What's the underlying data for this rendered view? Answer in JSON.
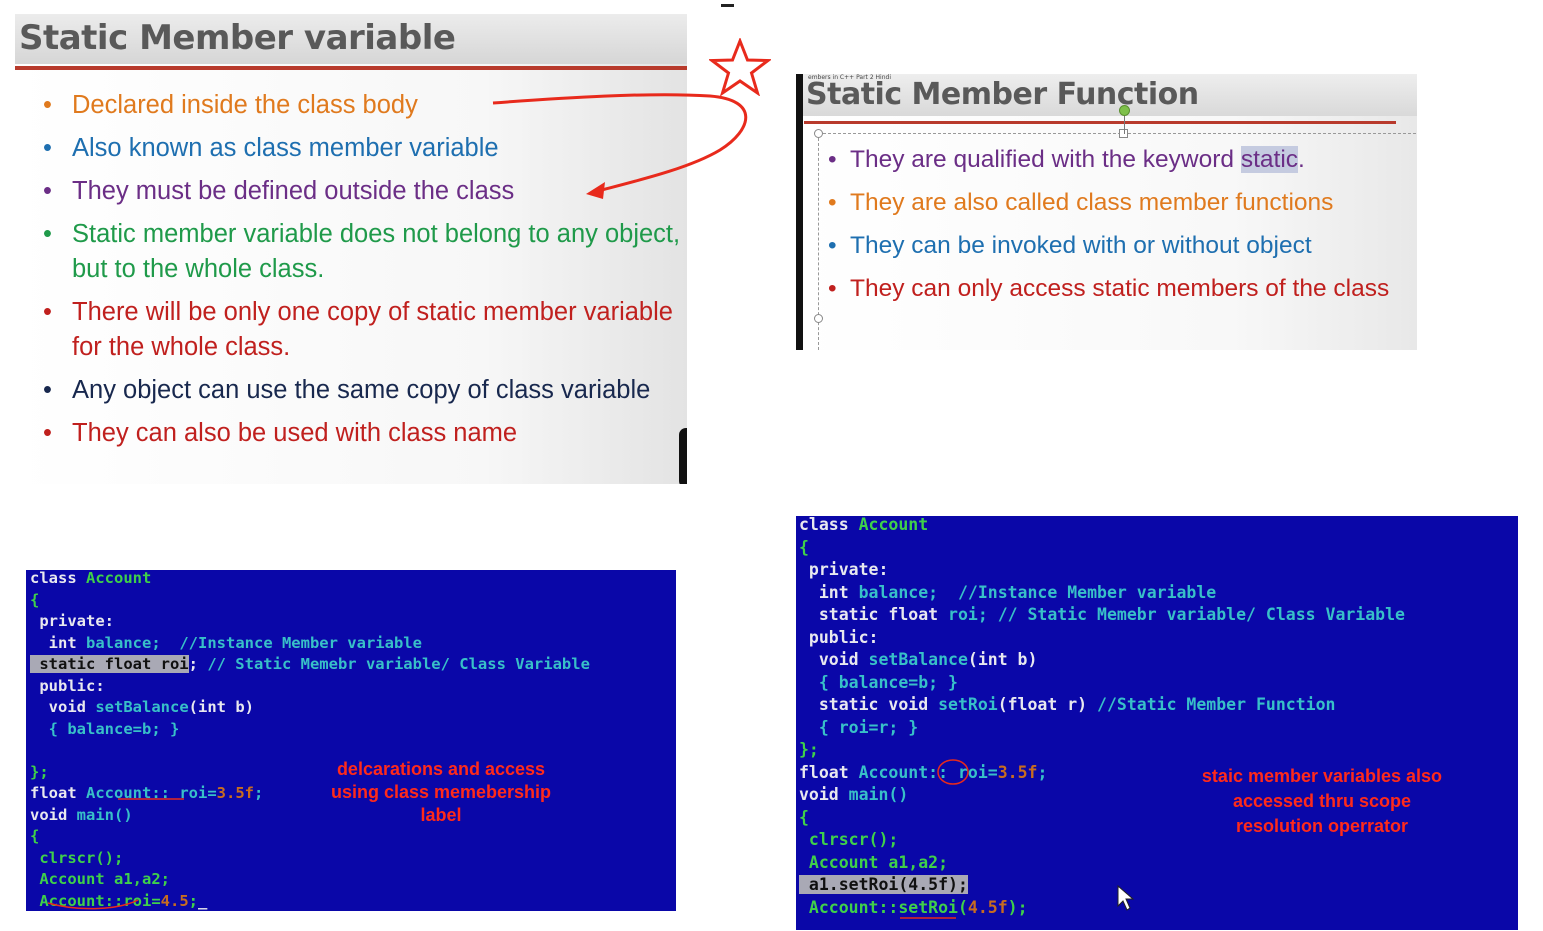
{
  "panel_variable": {
    "title": "Static Member variable",
    "bullets": [
      {
        "text": "Declared inside the class body",
        "color": "#e07a1e"
      },
      {
        "text": "Also known as class member variable",
        "color": "#1e6fb0"
      },
      {
        "text": "They must be defined outside the class",
        "color": "#6b2e86"
      },
      {
        "text": "Static member variable does not belong to any object, but to the whole class.",
        "color": "#1f9a4a"
      },
      {
        "text": "There will be only one copy of static member variable for the whole class.",
        "color": "#c0201e"
      },
      {
        "text": "Any object can use the same copy of class variable",
        "color": "#18284e"
      },
      {
        "text": "They can also be used with class name",
        "color": "#c0201e"
      }
    ],
    "bullet_symbol": "•"
  },
  "panel_function": {
    "tiny_caption": "embers in C++ Part 2 Hindi",
    "title": "Static Member Function",
    "bullets": [
      {
        "pre": "They are qualified with the keyword ",
        "hl": "static",
        "post": ".",
        "color": "#6b2e86"
      },
      {
        "pre": "They are also called class member functions",
        "hl": "",
        "post": "",
        "color": "#e07a1e"
      },
      {
        "pre": "They can be invoked with or without object",
        "hl": "",
        "post": "",
        "color": "#1e6fb0"
      },
      {
        "pre": "They can only access static members of the class",
        "hl": "",
        "post": "",
        "color": "#c0201e"
      }
    ],
    "bullet_symbol": "•"
  },
  "code_left": {
    "lines": [
      [
        {
          "t": "class ",
          "c": "c-white"
        },
        {
          "t": "Account",
          "c": "c-green"
        }
      ],
      [
        {
          "t": "{",
          "c": "c-green"
        }
      ],
      [
        {
          "t": " private:",
          "c": "c-white"
        }
      ],
      [
        {
          "t": "  int ",
          "c": "c-white"
        },
        {
          "t": "balance;  ",
          "c": "c-cyan"
        },
        {
          "t": "//Instance Member variable",
          "c": "c-cyan"
        }
      ],
      [
        {
          "t": " static float roi",
          "c": "hl"
        },
        {
          "t": "; ",
          "c": "c-white"
        },
        {
          "t": "// Static Memebr variable/ Class Variable",
          "c": "c-cyan"
        }
      ],
      [
        {
          "t": " public:",
          "c": "c-white"
        }
      ],
      [
        {
          "t": "  void ",
          "c": "c-white"
        },
        {
          "t": "setBalance",
          "c": "c-cyan"
        },
        {
          "t": "(int b)",
          "c": "c-white"
        }
      ],
      [
        {
          "t": "  { balance=b; }",
          "c": "c-cyan"
        }
      ],
      [
        {
          "t": "",
          "c": "c-white"
        }
      ],
      [
        {
          "t": "};",
          "c": "c-green"
        }
      ],
      [
        {
          "t": "float ",
          "c": "c-white"
        },
        {
          "t": "Account",
          "c": "c-cyan"
        },
        {
          "t": ":: roi=",
          "c": "c-cyan"
        },
        {
          "t": "3.5f",
          "c": "c-orange"
        },
        {
          "t": ";",
          "c": "c-cyan"
        }
      ],
      [
        {
          "t": "void ",
          "c": "c-white"
        },
        {
          "t": "main()",
          "c": "c-cyan"
        }
      ],
      [
        {
          "t": "{",
          "c": "c-green"
        }
      ],
      [
        {
          "t": " clrscr();",
          "c": "c-green"
        }
      ],
      [
        {
          "t": " Account a1,a2;",
          "c": "c-green"
        }
      ],
      [
        {
          "t": " Account::roi=",
          "c": "c-green"
        },
        {
          "t": "4.5",
          "c": "c-orange"
        },
        {
          "t": ";",
          "c": "c-green"
        },
        {
          "t": "_",
          "c": "c-white"
        }
      ]
    ],
    "annotation": "delcarations and access using class memebership label"
  },
  "code_right": {
    "lines": [
      [
        {
          "t": "class ",
          "c": "c-white"
        },
        {
          "t": "Account",
          "c": "c-green"
        }
      ],
      [
        {
          "t": "{",
          "c": "c-green"
        }
      ],
      [
        {
          "t": " private:",
          "c": "c-white"
        }
      ],
      [
        {
          "t": "  int ",
          "c": "c-white"
        },
        {
          "t": "balance;  ",
          "c": "c-cyan"
        },
        {
          "t": "//Instance Member variable",
          "c": "c-cyan"
        }
      ],
      [
        {
          "t": "  static float ",
          "c": "c-white"
        },
        {
          "t": "roi; ",
          "c": "c-cyan"
        },
        {
          "t": "// Static Memebr variable/ Class Variable",
          "c": "c-cyan"
        }
      ],
      [
        {
          "t": " public:",
          "c": "c-white"
        }
      ],
      [
        {
          "t": "  void ",
          "c": "c-white"
        },
        {
          "t": "setBalance",
          "c": "c-cyan"
        },
        {
          "t": "(int b)",
          "c": "c-white"
        }
      ],
      [
        {
          "t": "  { balance=b; }",
          "c": "c-cyan"
        }
      ],
      [
        {
          "t": "  static void ",
          "c": "c-white"
        },
        {
          "t": "setRoi",
          "c": "c-cyan"
        },
        {
          "t": "(float r) ",
          "c": "c-white"
        },
        {
          "t": "//Static Member Function",
          "c": "c-cyan"
        }
      ],
      [
        {
          "t": "  { roi=r; }",
          "c": "c-cyan"
        }
      ],
      [
        {
          "t": "};",
          "c": "c-green"
        }
      ],
      [
        {
          "t": "float ",
          "c": "c-white"
        },
        {
          "t": "Account",
          "c": "c-cyan"
        },
        {
          "t": ":: roi=",
          "c": "c-cyan"
        },
        {
          "t": "3.5f",
          "c": "c-orange"
        },
        {
          "t": ";",
          "c": "c-cyan"
        }
      ],
      [
        {
          "t": "void ",
          "c": "c-white"
        },
        {
          "t": "main()",
          "c": "c-cyan"
        }
      ],
      [
        {
          "t": "{",
          "c": "c-green"
        }
      ],
      [
        {
          "t": " clrscr();",
          "c": "c-green"
        }
      ],
      [
        {
          "t": " Account a1,a2;",
          "c": "c-green"
        }
      ],
      [
        {
          "t": " a1.setRoi(4.5f);",
          "c": "hl"
        }
      ],
      [
        {
          "t": " Account::",
          "c": "c-green"
        },
        {
          "t": "setRoi",
          "c": "c-green"
        },
        {
          "t": "(",
          "c": "c-green"
        },
        {
          "t": "4.5f",
          "c": "c-orange"
        },
        {
          "t": ");",
          "c": "c-green"
        }
      ]
    ],
    "annotation": "staic member variables also accessed thru scope resolution operrator"
  }
}
